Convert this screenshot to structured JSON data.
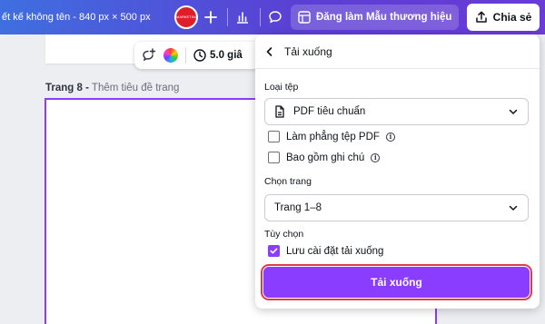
{
  "header": {
    "doc_title": "ết kế không tên - 840 px × 500 px",
    "avatar_text": "MARKETING",
    "template_label": "Đăng làm Mẫu thương hiệu",
    "share_label": "Chia sẻ"
  },
  "icons": [
    "plus-icon",
    "bar-chart-icon",
    "comment-icon",
    "template-icon",
    "share-upload-icon",
    "add-comment-icon",
    "color-wheel-icon",
    "clock-icon",
    "back-arrow-icon",
    "file-icon",
    "chevron-down-icon",
    "info-icon",
    "check-icon"
  ],
  "canvas": {
    "duration": "5.0 giâ",
    "page_label_bold": "Trang 8 -",
    "page_label_rest": " Thêm tiêu đề trang"
  },
  "panel": {
    "title": "Tải xuống",
    "file_type": {
      "label": "Loại tệp",
      "value": "PDF tiêu chuẩn"
    },
    "flatten": {
      "label": "Làm phẳng tệp PDF",
      "checked": false
    },
    "notes": {
      "label": "Bao gồm ghi chú",
      "checked": false
    },
    "pages": {
      "label": "Chọn trang",
      "value": "Trang 1–8"
    },
    "options": {
      "label": "Tùy chọn",
      "save_settings": {
        "label": "Lưu cài đặt tải xuống",
        "checked": true
      }
    },
    "download_label": "Tải xuống"
  },
  "colors": {
    "accent": "#8b3dff",
    "highlight": "#e23a4d",
    "topbar_start": "#3f6fe0",
    "topbar_end": "#6a3bd6"
  }
}
